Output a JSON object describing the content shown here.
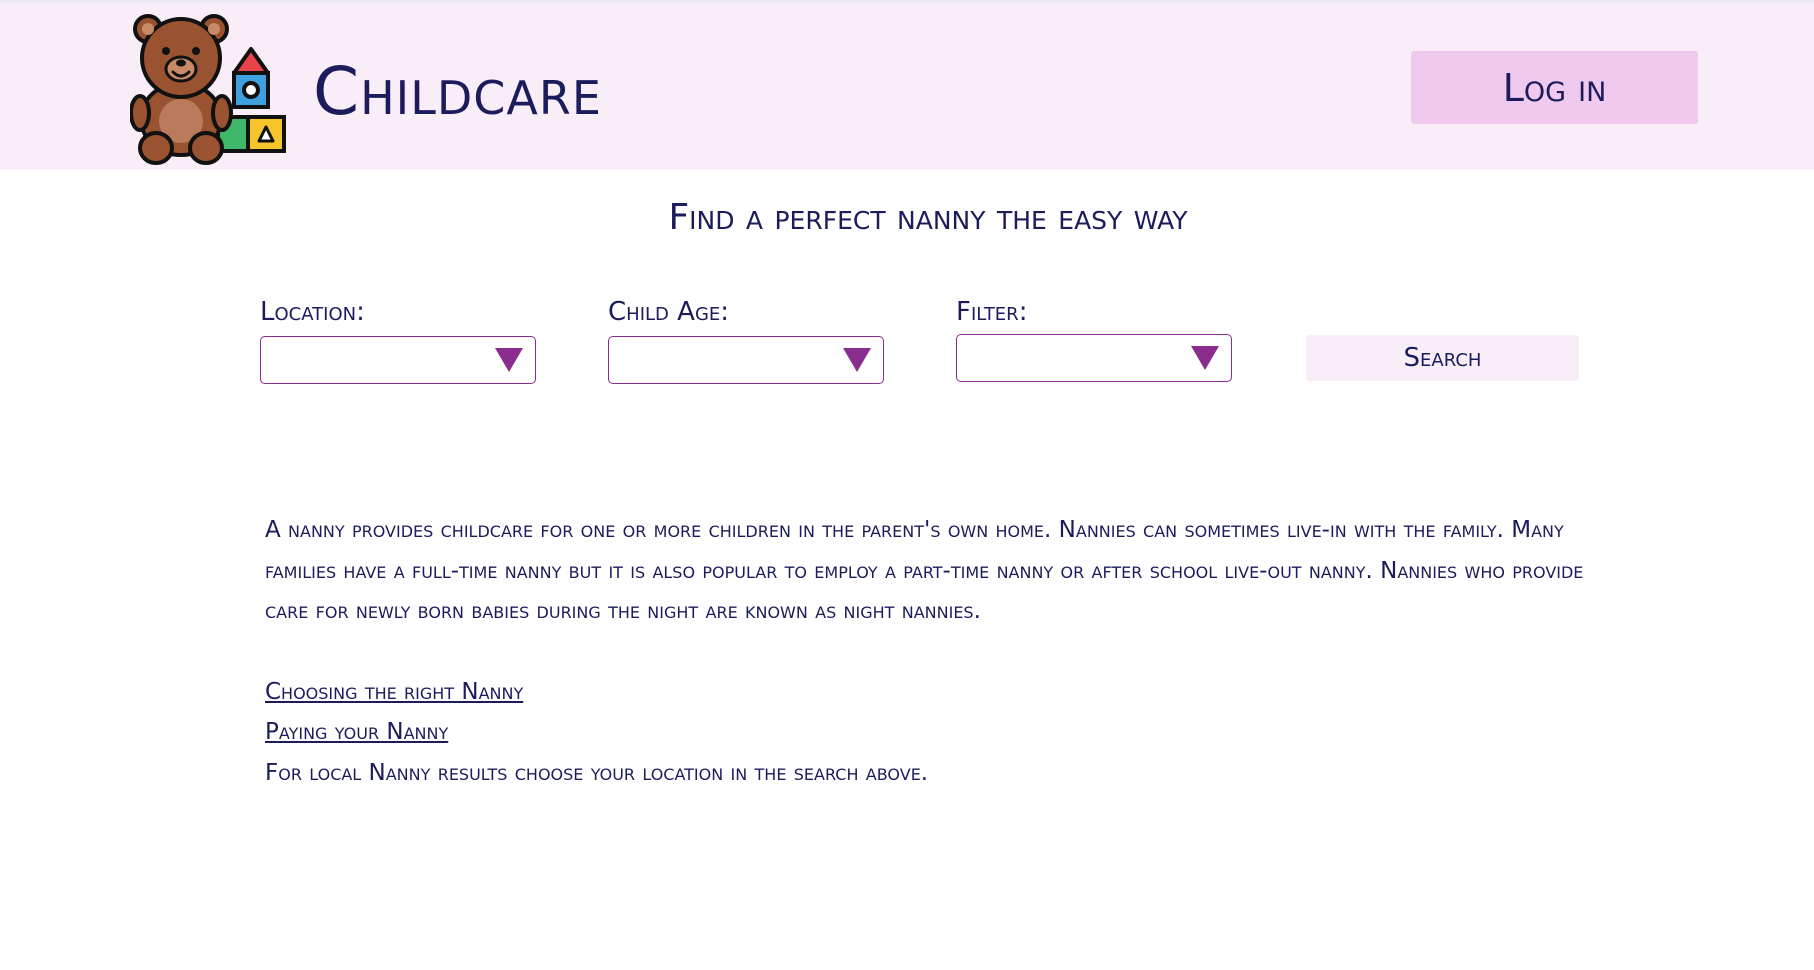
{
  "header": {
    "brand": "Childcare",
    "login_label": "Log in",
    "logo_icon": "teddy-bear-and-blocks-icon"
  },
  "tagline": "Find a perfect nanny the easy way",
  "search": {
    "location_label": "Location:",
    "location_value": "",
    "child_age_label": "Child Age:",
    "child_age_value": "",
    "filter_label": "Filter:",
    "filter_value": "",
    "button_label": "Search"
  },
  "content": {
    "intro": "A nanny provides childcare for one or more children in the parent's own home. Nannies can sometimes live-in with the family. Many families have a full-time nanny but it is also popular to employ a part-time nanny or after school live-out nanny. Nannies who provide care for newly born babies during the night are known as night nannies.",
    "link_choosing": "Choosing the right Nanny",
    "link_paying": "Paying your Nanny",
    "local_note": "For local Nanny results choose your location in the search above."
  },
  "colors": {
    "header_bg": "#f9eef8",
    "login_bg": "#efcaee",
    "text": "#1c1c5c",
    "accent": "#8a2d8e"
  }
}
